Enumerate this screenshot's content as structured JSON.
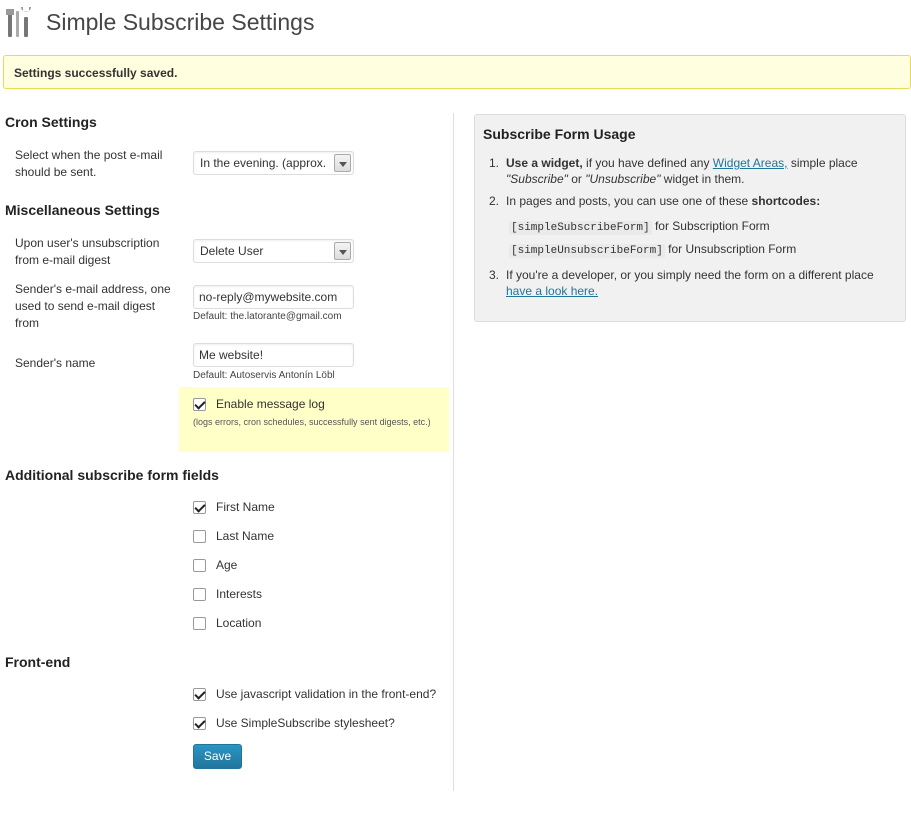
{
  "header": {
    "title": "Simple Subscribe Settings",
    "icon": "tools-icon"
  },
  "notice": {
    "text": "Settings successfully saved."
  },
  "cron": {
    "title": "Cron Settings",
    "label": "Select when the post e-mail should be sent.",
    "select_value": "In the evening. (approx."
  },
  "misc": {
    "title": "Miscellaneous Settings",
    "unsub_label": "Upon user's unsubscription from e-mail digest",
    "unsub_value": "Delete User",
    "email_label": "Sender's e-mail address, one used to send e-mail digest from",
    "email_value": "no-reply@mywebsite.com",
    "email_default": "Default: the.latorante@gmail.com",
    "name_label": "Sender's name",
    "name_value": "Me website!",
    "name_default": "Default: Autoservis Antonín Löbl",
    "log_label": "Enable message log",
    "log_desc": "(logs errors, cron schedules, successfully sent digests, etc.)",
    "log_checked": true
  },
  "fields": {
    "title": "Additional subscribe form fields",
    "items": [
      {
        "label": "First Name",
        "checked": true
      },
      {
        "label": "Last Name",
        "checked": false
      },
      {
        "label": "Age",
        "checked": false
      },
      {
        "label": "Interests",
        "checked": false
      },
      {
        "label": "Location",
        "checked": false
      }
    ]
  },
  "frontend": {
    "title": "Front-end",
    "items": [
      {
        "label": "Use javascript validation in the front-end?",
        "checked": true
      },
      {
        "label": "Use SimpleSubscribe stylesheet?",
        "checked": true
      }
    ],
    "save_label": "Save"
  },
  "usage": {
    "title": "Subscribe Form Usage",
    "item1_bold": "Use a widget,",
    "item1_pre": " if you have defined any ",
    "item1_link": "Widget Areas,",
    "item1_mid": " simple place ",
    "item1_em1": "\"Subscribe\"",
    "item1_or": " or ",
    "item1_em2": "\"Unsubscribe\"",
    "item1_post": " widget in them.",
    "item2_pre": "In pages and posts, you can use one of these ",
    "item2_bold": "shortcodes:",
    "code1": "[simpleSubscribeForm]",
    "code1_desc": " for Subscription Form",
    "code2": "[simpleUnsubscribeForm]",
    "code2_desc": " for Unsubscription Form",
    "item3_pre": "If you're a developer, or you simply need the form on a different place ",
    "item3_link": "have a look here."
  }
}
